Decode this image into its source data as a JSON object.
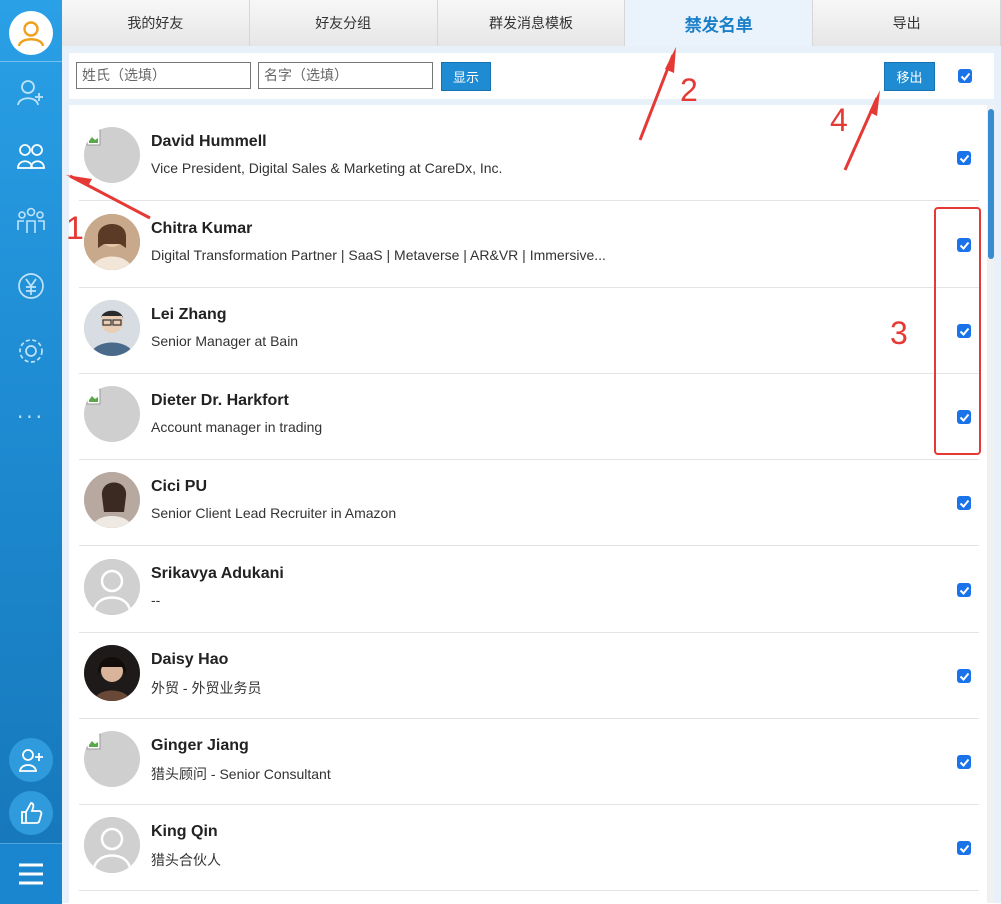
{
  "app": {
    "accent_color": "#1e8bd2"
  },
  "sidebar": {
    "items": [
      {
        "icon": "user-avatar-icon"
      },
      {
        "icon": "add-contact-icon"
      },
      {
        "icon": "friends-icon"
      },
      {
        "icon": "group-icon"
      },
      {
        "icon": "yuan-icon"
      },
      {
        "icon": "settings-icon"
      },
      {
        "icon": "more-icon",
        "label": "···"
      },
      {
        "icon": "add-friend-round-icon"
      },
      {
        "icon": "thumbs-up-icon"
      },
      {
        "icon": "menu-icon"
      }
    ]
  },
  "tabs": [
    {
      "label": "我的好友",
      "active": false
    },
    {
      "label": "好友分组",
      "active": false
    },
    {
      "label": "群发消息模板",
      "active": false
    },
    {
      "label": "禁发名单",
      "active": true
    },
    {
      "label": "导出",
      "active": false
    }
  ],
  "toolbar": {
    "lastname_placeholder": "姓氏（选填）",
    "firstname_placeholder": "名字（选填）",
    "lastname_value": "",
    "firstname_value": "",
    "show_label": "显示",
    "remove_label": "移出",
    "select_all_checked": true
  },
  "list": [
    {
      "name": "David Hummell",
      "title": "Vice President, Digital Sales & Marketing at CareDx, Inc.",
      "avatar": "broken",
      "checked": true
    },
    {
      "name": "Chitra Kumar",
      "title": "Digital Transformation Partner | SaaS | Metaverse | AR&VR | Immersive...",
      "avatar": "photo-woman",
      "checked": true
    },
    {
      "name": "Lei Zhang",
      "title": "Senior Manager at Bain",
      "avatar": "photo-man",
      "checked": true
    },
    {
      "name": "Dieter Dr. Harkfort",
      "title": "Account manager in trading",
      "avatar": "broken",
      "checked": true
    },
    {
      "name": "Cici PU",
      "title": "Senior Client Lead Recruiter in Amazon",
      "avatar": "photo-woman2",
      "checked": true
    },
    {
      "name": "Srikavya Adukani",
      "title": "--",
      "avatar": "default",
      "checked": true
    },
    {
      "name": "Daisy Hao",
      "title": "外贸 - 外贸业务员",
      "avatar": "photo-woman3",
      "checked": true
    },
    {
      "name": "Ginger Jiang",
      "title": "猎头顾问 - Senior Consultant",
      "avatar": "broken",
      "checked": true
    },
    {
      "name": "King Qin",
      "title": "猎头合伙人",
      "avatar": "default",
      "checked": true
    }
  ],
  "annotations": [
    "1",
    "2",
    "3",
    "4"
  ],
  "annotation_color": "#e53935"
}
